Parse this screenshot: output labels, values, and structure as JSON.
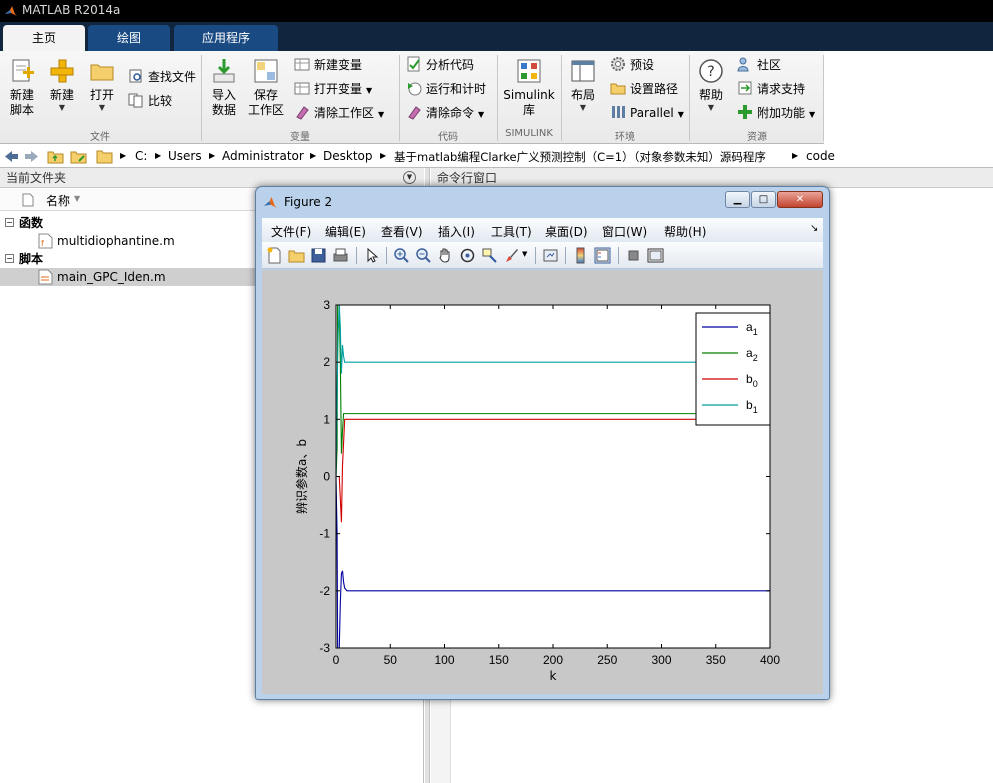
{
  "app": {
    "title": "MATLAB R2014a"
  },
  "tabs": [
    {
      "label": "主页",
      "active": true
    },
    {
      "label": "绘图",
      "active": false
    },
    {
      "label": "应用程序",
      "active": false
    }
  ],
  "ribbon": {
    "file": {
      "group_label": "文件",
      "new_script": "新建\n脚本",
      "new": "新建",
      "open": "打开",
      "find_files": "查找文件",
      "compare": "比较"
    },
    "variable": {
      "group_label": "变量",
      "import_data": "导入\n数据",
      "save_workspace": "保存\n工作区",
      "new_variable": "新建变量",
      "open_variable": "打开变量",
      "clear_workspace": "清除工作区"
    },
    "code": {
      "group_label": "代码",
      "analyze_code": "分析代码",
      "run_and_time": "运行和计时",
      "clear_commands": "清除命令"
    },
    "simulink": {
      "group_label": "SIMULINK",
      "library": "Simulink\n库"
    },
    "environment": {
      "group_label": "环境",
      "layout": "布局",
      "preferences": "预设",
      "set_path": "设置路径",
      "parallel": "Parallel"
    },
    "resources": {
      "group_label": "资源",
      "help": "帮助",
      "community": "社区",
      "request_support": "请求支持",
      "add_ons": "附加功能"
    }
  },
  "address_bar": {
    "crumbs": [
      "C:",
      "Users",
      "Administrator",
      "Desktop",
      "基于matlab编程Clarke广义预测控制（C=1）（对象参数未知）源码程序",
      "code"
    ]
  },
  "current_folder": {
    "title": "当前文件夹",
    "column_name": "名称",
    "groups": [
      {
        "label": "函数",
        "files": [
          "multidiophantine.m"
        ]
      },
      {
        "label": "脚本",
        "files": [
          "main_GPC_Iden.m"
        ]
      }
    ]
  },
  "command_window": {
    "title": "命令行窗口"
  },
  "figure": {
    "title": "Figure 2",
    "menu": [
      "文件(F)",
      "编辑(E)",
      "查看(V)",
      "插入(I)",
      "工具(T)",
      "桌面(D)",
      "窗口(W)",
      "帮助(H)"
    ],
    "toolbar_icons": [
      "new-figure-icon",
      "open-file-icon",
      "save-icon",
      "print-icon",
      "edit-plot-arrow-icon",
      "zoom-in-icon",
      "zoom-out-icon",
      "pan-hand-icon",
      "rotate-3d-icon",
      "data-cursor-icon",
      "brush-icon",
      "link-plot-icon",
      "colorbar-icon",
      "legend-icon",
      "hide-plot-tools-icon",
      "show-plot-tools-icon"
    ]
  },
  "chart_data": {
    "type": "line",
    "title": "",
    "xlabel": "k",
    "ylabel": "辨识参数a、b",
    "xlim": [
      0,
      400
    ],
    "ylim": [
      -3,
      3
    ],
    "xticks": [
      0,
      50,
      100,
      150,
      200,
      250,
      300,
      350,
      400
    ],
    "yticks": [
      -3,
      -2,
      -1,
      0,
      1,
      2,
      3
    ],
    "grid": false,
    "legend_position": "top-right",
    "series": [
      {
        "name": "a1",
        "color": "#0000a0",
        "x": [
          0,
          1,
          1.5,
          2,
          2.5,
          3,
          4,
          5,
          6,
          7,
          8,
          10,
          15,
          30,
          100,
          200,
          300,
          400
        ],
        "y": [
          0,
          -1.0,
          -3.0,
          -3.0,
          -3.0,
          -3.0,
          -2.2,
          -1.7,
          -1.65,
          -1.85,
          -1.95,
          -2.0,
          -2.0,
          -2.0,
          -2.0,
          -2.0,
          -2.0,
          -2.0
        ]
      },
      {
        "name": "a2",
        "color": "#008000",
        "x": [
          0,
          1,
          1.5,
          2,
          2.5,
          3,
          4,
          5,
          6,
          7,
          8,
          10,
          15,
          30,
          100,
          200,
          300,
          400
        ],
        "y": [
          0,
          0.5,
          3.0,
          3.0,
          3.0,
          3.0,
          2.0,
          0.4,
          0.8,
          1.1,
          1.1,
          1.1,
          1.1,
          1.1,
          1.1,
          1.1,
          1.1,
          1.1
        ]
      },
      {
        "name": "b0",
        "color": "#d00000",
        "x": [
          0,
          1,
          2,
          3,
          4,
          5,
          6,
          8,
          10,
          30,
          100,
          200,
          300,
          400
        ],
        "y": [
          0,
          0,
          0,
          0,
          -0.4,
          -0.8,
          0.2,
          1.0,
          1.0,
          1.0,
          1.0,
          1.0,
          1.0,
          1.0
        ]
      },
      {
        "name": "b1",
        "color": "#00a0a0",
        "x": [
          0,
          1,
          2,
          3,
          4,
          5,
          6,
          7,
          8,
          10,
          15,
          30,
          100,
          200,
          300,
          400
        ],
        "y": [
          0,
          1.5,
          2.5,
          3.0,
          2.6,
          1.8,
          2.3,
          2.1,
          2.0,
          2.0,
          2.0,
          2.0,
          2.0,
          2.0,
          2.0,
          2.0
        ]
      }
    ]
  }
}
